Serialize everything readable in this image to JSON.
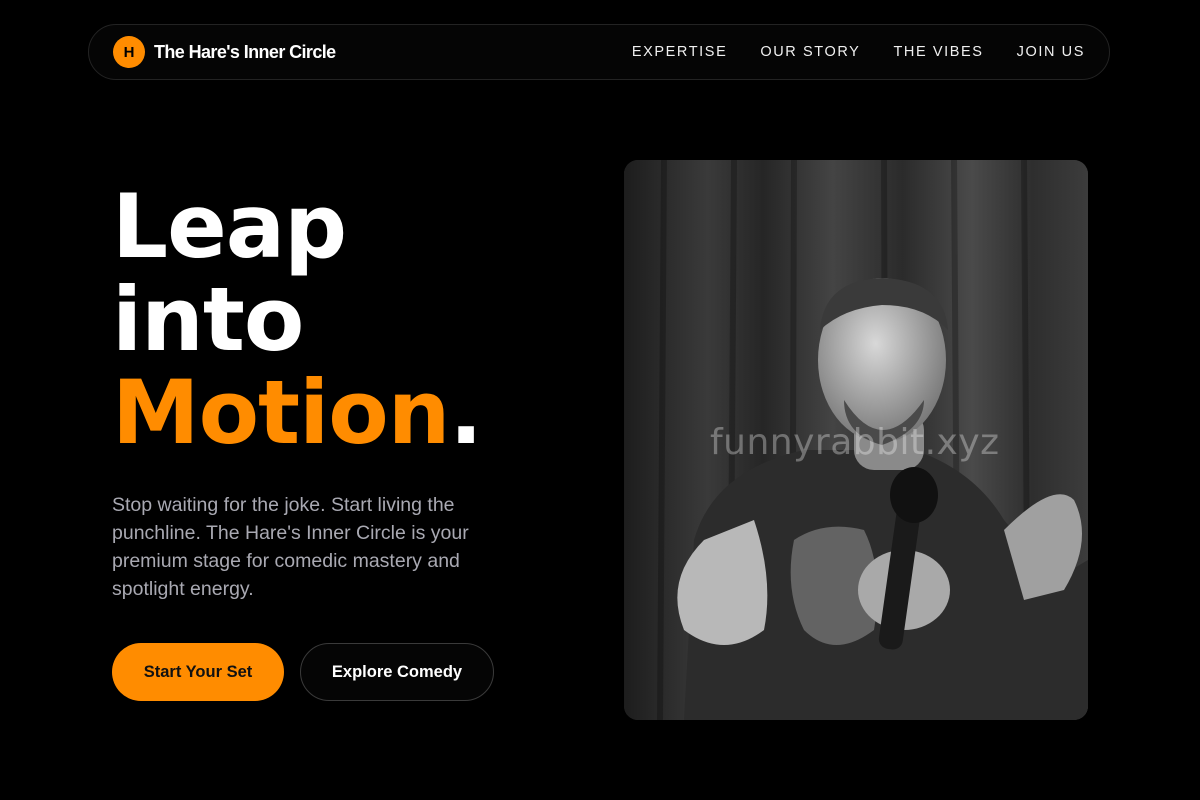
{
  "nav": {
    "brand_initial": "H",
    "brand_name": "The Hare's Inner Circle",
    "links": [
      "EXPERTISE",
      "OUR STORY",
      "THE VIBES",
      "JOIN US"
    ]
  },
  "hero": {
    "line1": "Leap",
    "line2": "into",
    "line3_accent": "Motion",
    "line3_dot": ".",
    "subtitle": "Stop waiting for the joke. Start living the punchline. The Hare's Inner Circle is your premium stage for comedic mastery and spotlight energy.",
    "primary_cta": "Start Your Set",
    "secondary_cta": "Explore Comedy"
  },
  "photo": {
    "watermark": "funnyrabbit.xyz"
  },
  "colors": {
    "accent": "#ff8c00",
    "background": "#000000",
    "subtitle_text": "#a9a9b2"
  }
}
